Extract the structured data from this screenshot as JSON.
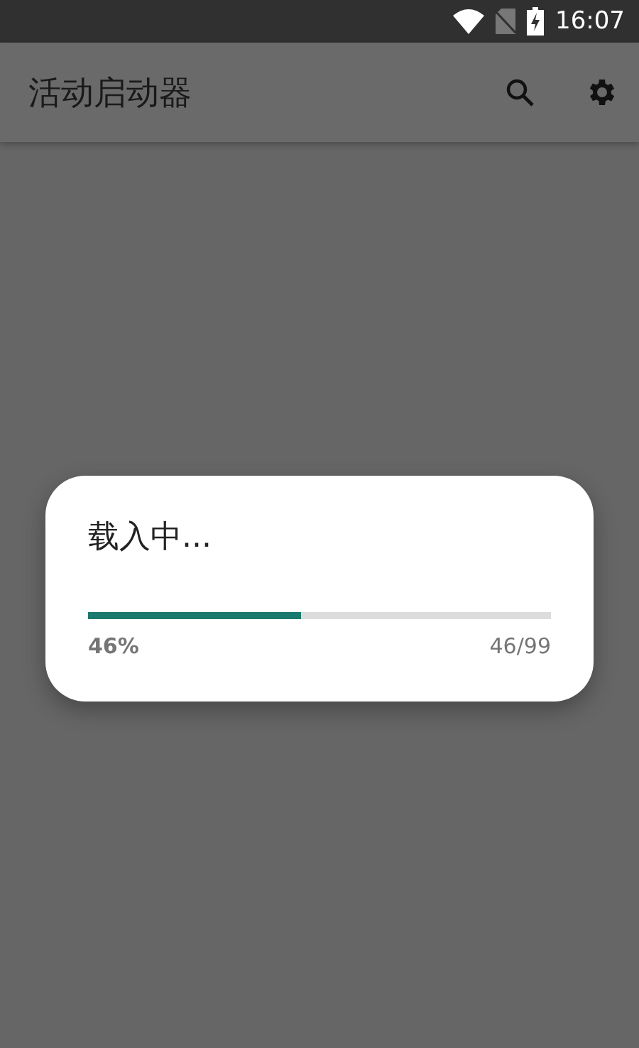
{
  "status_bar": {
    "time": "16:07"
  },
  "app_bar": {
    "title": "活动启动器"
  },
  "dialog": {
    "title": "载入中...",
    "progress": {
      "level": 0.46,
      "percent": "46%",
      "count": "46/99"
    }
  }
}
